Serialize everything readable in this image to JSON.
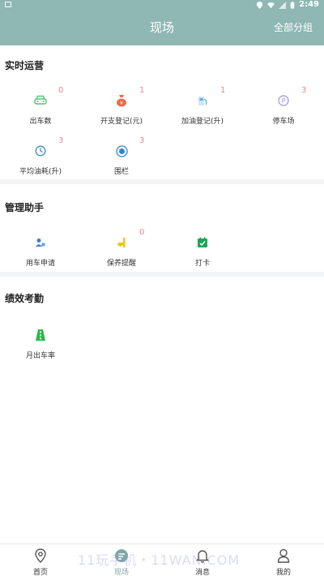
{
  "status_bar": {
    "time": "2:49",
    "icons": [
      "location-icon",
      "wifi-icon",
      "signal-icon",
      "battery-icon"
    ]
  },
  "header": {
    "title": "现场",
    "right_action": "全部分组"
  },
  "sections": {
    "realtime": {
      "title": "实时运营",
      "items": [
        {
          "label": "出车数",
          "count": "0",
          "icon": "car-icon",
          "color": "#56c271"
        },
        {
          "label": "开支登记(元)",
          "count": "1",
          "icon": "money-bag-icon",
          "color": "#f06a4a"
        },
        {
          "label": "加油登记(升)",
          "count": "1",
          "icon": "fuel-icon",
          "color": "#5aaee6"
        },
        {
          "label": "停车场",
          "count": "3",
          "icon": "parking-icon",
          "color": "#9b8fe0"
        },
        {
          "label": "平均油耗(升)",
          "count": "3",
          "icon": "timer-icon",
          "color": "#3a8fd6"
        },
        {
          "label": "围栏",
          "count": "3",
          "icon": "fence-target-icon",
          "color": "#2f86d1"
        }
      ]
    },
    "assistant": {
      "title": "管理助手",
      "items": [
        {
          "label": "用车申请",
          "count": "",
          "icon": "user-car-request-icon",
          "color": "#3f7fd0"
        },
        {
          "label": "保养提醒",
          "count": "0",
          "icon": "maintenance-icon",
          "color": "#f0c419"
        },
        {
          "label": "打卡",
          "count": "",
          "icon": "checkin-icon",
          "color": "#1fa35a"
        }
      ]
    },
    "performance": {
      "title": "绩效考勤",
      "items": [
        {
          "label": "月出车率",
          "count": "",
          "icon": "road-icon",
          "color": "#2eb84a"
        }
      ]
    }
  },
  "tabbar": {
    "tabs": [
      {
        "label": "首页",
        "icon": "location-pin-icon"
      },
      {
        "label": "现场",
        "icon": "scene-icon",
        "active": true
      },
      {
        "label": "消息",
        "icon": "bell-icon"
      },
      {
        "label": "我的",
        "icon": "profile-icon"
      }
    ],
    "watermark": "11玩手机・11WAN.COM"
  },
  "colors": {
    "header_bg": "#8fb7b4",
    "badge": "#e98a8a",
    "active_tab": "#7fa7a4"
  }
}
